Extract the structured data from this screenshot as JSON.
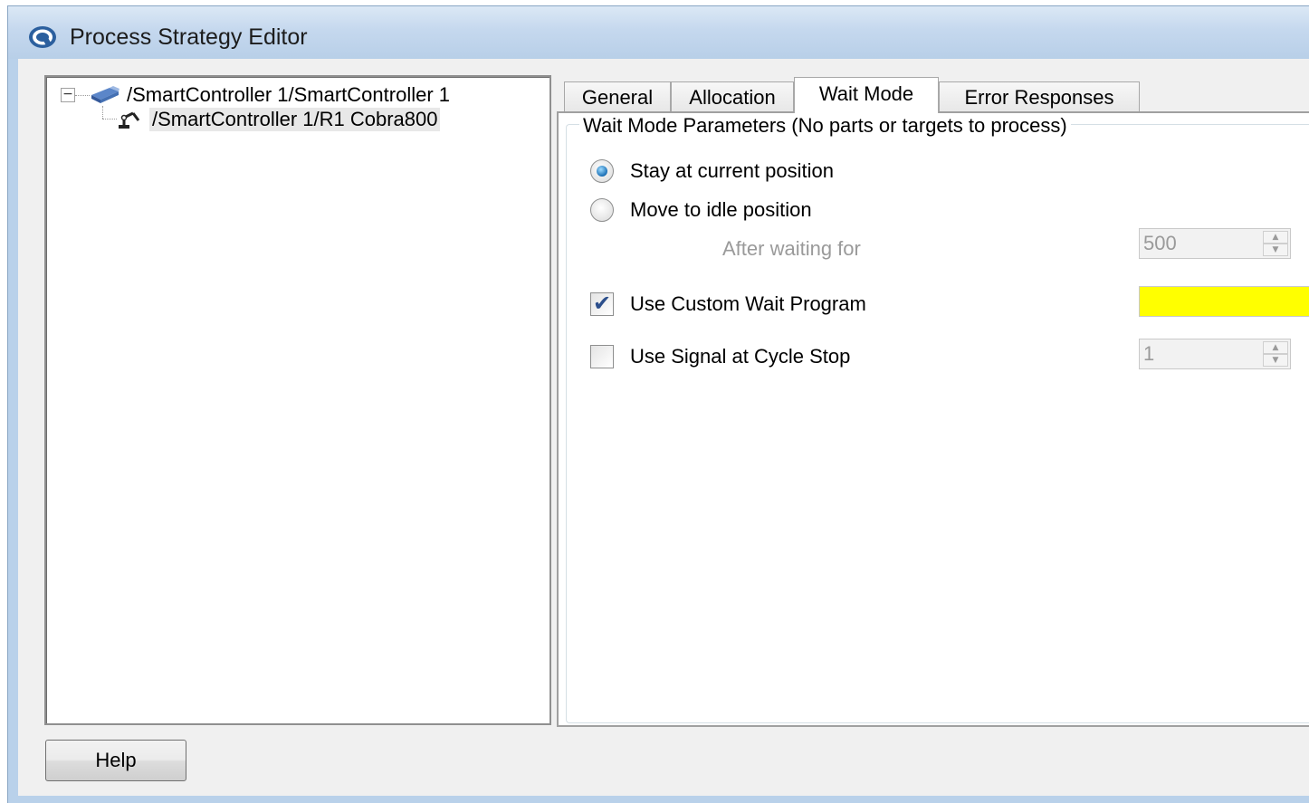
{
  "window": {
    "title": "Process Strategy Editor"
  },
  "tree": {
    "root": {
      "expander": "−",
      "label": "/SmartController 1/SmartController 1"
    },
    "child": {
      "label": "/SmartController 1/R1 Cobra800"
    }
  },
  "tabs": [
    {
      "label": "General",
      "selected": false
    },
    {
      "label": "Allocation",
      "selected": false
    },
    {
      "label": "Wait Mode",
      "selected": true
    },
    {
      "label": "Error Responses",
      "selected": false
    }
  ],
  "wait_mode": {
    "group_title": "Wait Mode Parameters (No parts or targets to process)",
    "stay_label": "Stay at current position",
    "stay_selected": true,
    "move_label": "Move to idle position",
    "move_selected": false,
    "after_waiting_label": "After waiting for",
    "after_waiting_value": "500",
    "custom_program_label": "Use Custom Wait Program",
    "custom_program_checked": true,
    "custom_program_field_color": "#ffff00",
    "signal_label": "Use Signal at Cycle Stop",
    "signal_checked": false,
    "signal_value": "1"
  },
  "footer": {
    "help_label": "Help"
  },
  "colors": {
    "window_frame": "#b9d1ea",
    "client_bg": "#f0f0f0",
    "radio_accent": "#1a6fb5"
  }
}
